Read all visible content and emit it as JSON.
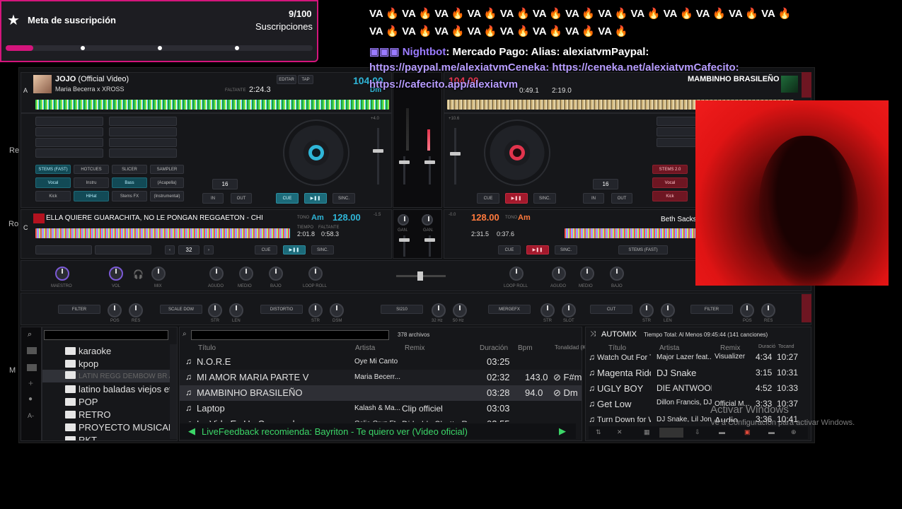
{
  "goal": {
    "star_icon": "star-icon",
    "title": "Meta de suscripción",
    "count": "9/100",
    "label": "Suscripciones",
    "progress": 0.09,
    "accent": "#d4157c"
  },
  "chat": {
    "line1": "VA 🔥 VA 🔥 VA 🔥 VA 🔥 VA 🔥 VA 🔥 VA 🔥 VA 🔥 VA 🔥 VA 🔥 VA 🔥 VA 🔥 VA 🔥",
    "line2": "VA 🔥 VA 🔥 VA 🔥 VA 🔥 VA 🔥 VA 🔥 VA 🔥 VA 🔥",
    "nightbot_name": "Nightbot",
    "nightbot_msg": ": Mercado Pago: Alias: alexiatvmPaypal:",
    "link1": "https://paypal.me/alexiatvmCeneka: https://ceneka.net/alexiatvmCafecito:",
    "link2": "https://cafecito.app/alexiatvm"
  },
  "deckA": {
    "letter": "A",
    "title": "JOJO",
    "title_suffix": "(Official Video)",
    "artist": "Maria Becerra x XROSS",
    "remaining_label": "FALTANTE",
    "remaining": "2:24.3",
    "bpm": "104.00",
    "key_label": "Dm",
    "btn_edit": "EDITAR",
    "btn_tap": "TAP",
    "stems_label": "STEMS (FAST)",
    "hotcues": "HOTCUES",
    "slicer": "SLICER",
    "sampler": "SAMPLER",
    "vocal": "Vocal",
    "instru": "Instru",
    "bass": "Bass",
    "acapella": "(Acapella)",
    "kick": "Kick",
    "hihat": "HiHat",
    "stems_fx": "Stems FX",
    "instrumental": "(Instrumental)",
    "loop": "16",
    "in": "IN",
    "out": "OUT",
    "cue": "CUE",
    "sync": "SINC.",
    "pitch": "+4.0"
  },
  "deckB": {
    "title": "MAMBINHO BRASILEÑO",
    "bpm": "104.00",
    "elapsed": "0:49.1",
    "remaining": "2:19.0",
    "loop": "16",
    "in": "IN",
    "out": "OUT",
    "cue": "CUE",
    "sync": "SINC.",
    "pitch": "+10.6",
    "stems": "STEMS 2.0",
    "vocal": "Vocal",
    "kick": "Kick"
  },
  "deckC": {
    "letter": "C",
    "title": "ELLA QUIERE GUARACHITA, NO LE PONGAN REGGAETON - CHI",
    "key_label": "TONO",
    "key": "Am",
    "bpm": "128.00",
    "time_label": "TIEMPO",
    "time": "2:01.8",
    "remaining_label": "FALTANTE",
    "remaining": "0:58.3",
    "loop": "32",
    "cue": "CUE",
    "sync": "SINC."
  },
  "deckD": {
    "bpm": "128.00",
    "key_label": "TONO",
    "key": "Am",
    "time": "2:31.5",
    "remaining": "0:37.6",
    "artist": "Beth Sacks",
    "cue": "CUE",
    "sync": "SINC.",
    "stems": "STEMS (FAST)"
  },
  "mixer": {
    "left": {
      "master": "MAESTRO",
      "vol": "VOL",
      "mix": "MIX",
      "agudo": "AGUDO",
      "medio": "MEDIO",
      "bajo": "BAJO",
      "loop_roll": "LOOP ROLL"
    },
    "right": {
      "loop_roll": "LOOP ROLL",
      "agudo": "AGUDO",
      "medio": "MEDIO",
      "bajo": "BAJO"
    },
    "gain": "GAN.",
    "pitch_c": "-1.5",
    "pitch_d": "-0.0"
  },
  "fx": {
    "filter": "FILTER",
    "pos": "POS",
    "res": "RES",
    "scale": "SCALE DOW",
    "str": "STR",
    "len": "LEN",
    "distortion": "DISTORTIO",
    "dsm": "DSM",
    "si210": "SI210",
    "hz32": "32 Hz",
    "hz50": "50 Hz",
    "mergefx": "MERGEFX",
    "slot": "SLOT",
    "cut": "CUT",
    "filter2": "FILTER"
  },
  "browser": {
    "count": "378 archivos",
    "folders": [
      "karaoke",
      "kpop",
      "LATIN REGG DEMBOW BR AF",
      "latino baladas viejos etc",
      "POP",
      "RETRO",
      "PROYECTO MUSICAL",
      "RKT"
    ],
    "columns": [
      "Título",
      "Artista",
      "Remix",
      "Duración",
      "Bpm",
      "Tonalidad (Key)"
    ],
    "tracks": [
      {
        "title": "N.O.R.E",
        "artist": "Oye Mi Canto",
        "remix": "",
        "dur": "03:25",
        "bpm": "",
        "key": ""
      },
      {
        "title": "MI AMOR   MARIA  PARTE V",
        "artist": "Maria Becerr...",
        "remix": "",
        "dur": "02:32",
        "bpm": "143.0",
        "key": "F#m"
      },
      {
        "title": "MAMBINHO BRASILEÑO",
        "artist": "",
        "remix": "",
        "dur": "03:28",
        "bpm": "94.0",
        "key": "Dm"
      },
      {
        "title": "Laptop",
        "artist": "Kalash & Ma...",
        "remix": "Clip officiel",
        "dur": "03:03",
        "bpm": "",
        "key": ""
      },
      {
        "title": "La Vida Es Un Carnaval",
        "artist": "Celia Cruz Ft...",
        "remix": "Dj Luh's Shatta Remix",
        "dur": "02:55",
        "bpm": "",
        "key": ""
      }
    ],
    "feedback": "LiveFeedback recomienda: Bayriton - Te quiero ver (Video oficial)"
  },
  "automix": {
    "title": "AUTOMIX",
    "total": "Tiempo Total: Al Menos 09:45:44 (141 canciones)",
    "columns": [
      "Título",
      "Artista",
      "Remix",
      "Duració",
      "Tocand"
    ],
    "rows": [
      {
        "title": "Watch Out For Th...",
        "artist": "Major Lazer feat...",
        "remix": "Visualizer",
        "dur": "4:34",
        "play": "10:27"
      },
      {
        "title": "Magenta Riddim",
        "artist": "DJ Snake",
        "remix": "",
        "dur": "3:15",
        "play": "10:31"
      },
      {
        "title": "UGLY BOY",
        "artist": "DIE ANTWOORD",
        "remix": "",
        "dur": "4:52",
        "play": "10:33"
      },
      {
        "title": "Get Low",
        "artist": "Dillon Francis, DJ...",
        "remix": "Official M...",
        "dur": "3:33",
        "play": "10:37"
      },
      {
        "title": "Turn Down for W...",
        "artist": "DJ Snake, Lil Jon",
        "remix": "Audio",
        "dur": "3:36",
        "play": "10:41"
      }
    ]
  },
  "windows": {
    "activate": "Activar Windows",
    "activate_sub": "Ve a Configuración para activar Windows."
  },
  "side_letters": [
    "Re",
    "Ro",
    "M"
  ]
}
